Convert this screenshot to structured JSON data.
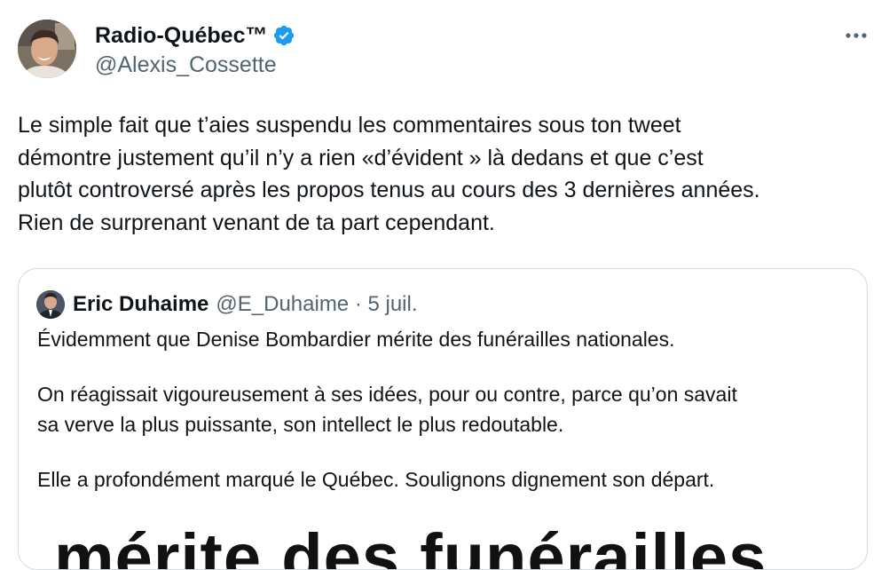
{
  "tweet": {
    "author": {
      "name": "Radio-Québec™",
      "handle": "@Alexis_Cossette",
      "verified": true
    },
    "more_icon": "more-horizontal-icon",
    "text_lines": [
      "Le simple fait que t’aies suspendu les commentaires sous ton tweet",
      "démontre justement qu’il n’y a rien «d’évident » là dedans et que c’est",
      "plutôt controversé après les propos tenus au cours des 3 dernières années.",
      "Rien de surprenant venant de ta part cependant."
    ]
  },
  "quoted_tweet": {
    "author_name": "Eric Duhaime",
    "meta": "@E_Duhaime · 5 juil.",
    "paragraphs": [
      [
        "Évidemment que Denise Bombardier mérite des funérailles nationales."
      ],
      [
        "On réagissait vigoureusement à ses idées, pour ou contre, parce qu’on savait",
        "sa verve la plus puissante, son intellect le plus redoutable."
      ],
      [
        "Elle a profondément marqué le Québec. Soulignons dignement son départ."
      ]
    ],
    "media_text": "mérite des funérailles"
  },
  "colors": {
    "text": "#0f1419",
    "secondary": "#536471",
    "verified_blue": "#1d9bf0",
    "border": "#cfd9de"
  }
}
